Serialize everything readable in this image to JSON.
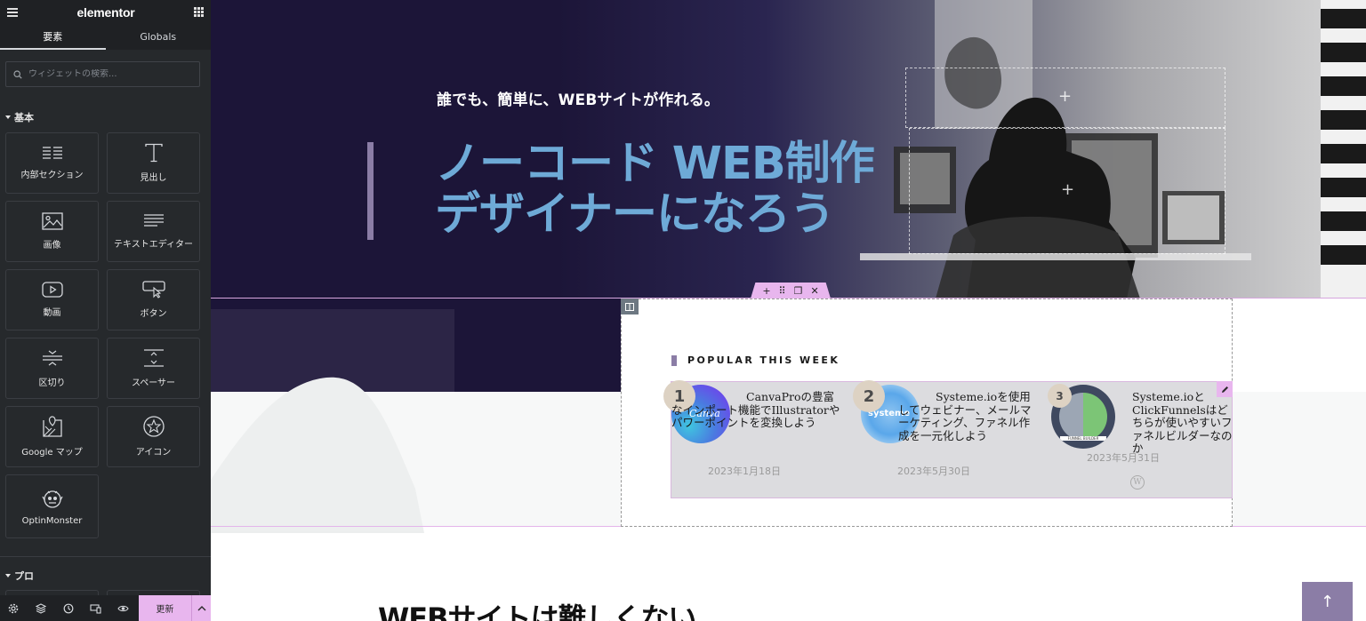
{
  "sidebar": {
    "logo": "elementor",
    "tabs": [
      {
        "label": "要素",
        "active": true
      },
      {
        "label": "Globals",
        "active": false
      }
    ],
    "search": {
      "placeholder": "ウィジェットの検索..."
    },
    "categories": {
      "basic": "基本",
      "pro": "プロ"
    },
    "widgets": [
      {
        "label": "内部セクション",
        "icon": "inner-section-icon"
      },
      {
        "label": "見出し",
        "icon": "heading-icon"
      },
      {
        "label": "画像",
        "icon": "image-icon"
      },
      {
        "label": "テキストエディター",
        "icon": "text-editor-icon"
      },
      {
        "label": "動画",
        "icon": "video-icon"
      },
      {
        "label": "ボタン",
        "icon": "button-icon"
      },
      {
        "label": "区切り",
        "icon": "divider-icon"
      },
      {
        "label": "スペーサー",
        "icon": "spacer-icon"
      },
      {
        "label": "Google マップ",
        "icon": "google-maps-icon"
      },
      {
        "label": "アイコン",
        "icon": "star-icon"
      },
      {
        "label": "OptinMonster",
        "icon": "optinmonster-icon"
      }
    ],
    "footer": {
      "update_label": "更新"
    }
  },
  "hero": {
    "subtitle": "誰でも、簡単に、WEBサイトが作れる。",
    "title_line1": "ノーコード WEB制作",
    "title_line2": "デザイナーになろう"
  },
  "popular": {
    "heading": "POPULAR THIS WEEK",
    "posts": [
      {
        "rank": "1",
        "title": "CanvaProの豊富なインポート機能でIllustratorやパワーポイントを変換しよう",
        "date": "2023年1月18日",
        "thumb_text": "Canva"
      },
      {
        "rank": "2",
        "title": "Systeme.ioを使用してウェビナー、メールマーケティング、ファネル作成を一元化しよう",
        "date": "2023年5月30日",
        "thumb_text": "systeme"
      },
      {
        "rank": "3",
        "title": "Systeme.ioとClickFunnelsはどちらが使いやすいファネルビルダーなのか",
        "date": "2023年5月31日",
        "thumb_text": "FUNNEL BUILDER"
      }
    ]
  },
  "section": {
    "heading": "WEBサイトは難しくない"
  },
  "colors": {
    "accent": "#e8b6ee",
    "hero_title": "#6eaad7",
    "hero_bg": "#1c1538",
    "brand_bar": "#8b7da6"
  }
}
